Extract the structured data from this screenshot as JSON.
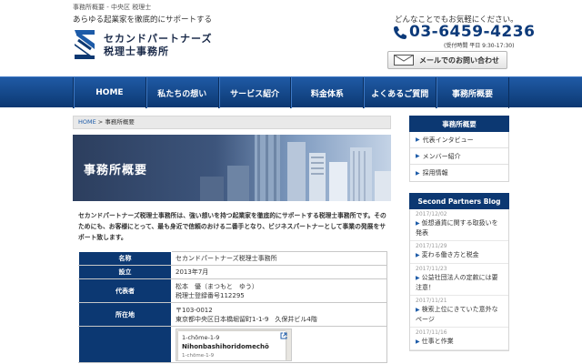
{
  "header": {
    "breadcrumb_top": "事務所概要 - 中央区 税理士",
    "tagline": "あらゆる起業家を徹底的にサポートする",
    "firm_name_line1": "セカンドパートナーズ",
    "firm_name_line2": "税理士事務所",
    "contact_message": "どんなことでもお気軽にください。",
    "phone": "03-6459-4236",
    "hours": "(受付時間 平日 9:30-17:30)",
    "mail_button_label": "メールでのお問い合わせ"
  },
  "nav": {
    "items": [
      "HOME",
      "私たちの想い",
      "サービス紹介",
      "料金体系",
      "よくあるご質問",
      "事務所概要"
    ]
  },
  "crumb": {
    "home": "HOME",
    "separator": " > ",
    "current": "事務所概要"
  },
  "hero": {
    "title": "事務所概要"
  },
  "intro": {
    "text": "セカンドパートナーズ税理士事務所は、強い想いを持つ起業家を徹底的にサポートする税理士事務所です。そのためにも、お客様にとって、最も身近で信頼のおける二番手となり、ビジネスパートナーとして事業の発展をサポート致します。"
  },
  "table": {
    "rows": [
      {
        "label": "名称",
        "value": "セカンドパートナーズ税理士事務所"
      },
      {
        "label": "設立",
        "value": "2013年7月"
      },
      {
        "label": "代表者",
        "value": "松本　優（まつもと　ゆう）",
        "value2": "税理士登録番号112295"
      },
      {
        "label": "所在地",
        "value": "〒103-0012",
        "value2": "東京都中央区日本橋堀留町1-1-9　久保井ビル4階"
      },
      {
        "label": "",
        "value": ""
      }
    ],
    "map": {
      "line1": "1-chōme-1-9",
      "line2": "Nihonbashihoridomechō",
      "line3": "1-chōme-1-9"
    }
  },
  "sidebar": {
    "section_title": "事務所概要",
    "items": [
      "代表インタビュー",
      "メンバー紹介",
      "採用情報"
    ],
    "blog_title": "Second Partners Blog",
    "blog": [
      {
        "date": "2017/12/02",
        "title": "仮想通貨に関する取扱いを発表"
      },
      {
        "date": "2017/11/29",
        "title": "変わる働き方と税金"
      },
      {
        "date": "2017/11/23",
        "title": "公益社団法人の定款には要注意！"
      },
      {
        "date": "2017/11/21",
        "title": "検索上位にきていた意外なページ"
      },
      {
        "date": "2017/11/16",
        "title": "仕事と作業"
      }
    ]
  },
  "colors": {
    "navy": "#0c3872",
    "nav_light": "#1f5aa5",
    "link_blue": "#1d5ba8"
  }
}
